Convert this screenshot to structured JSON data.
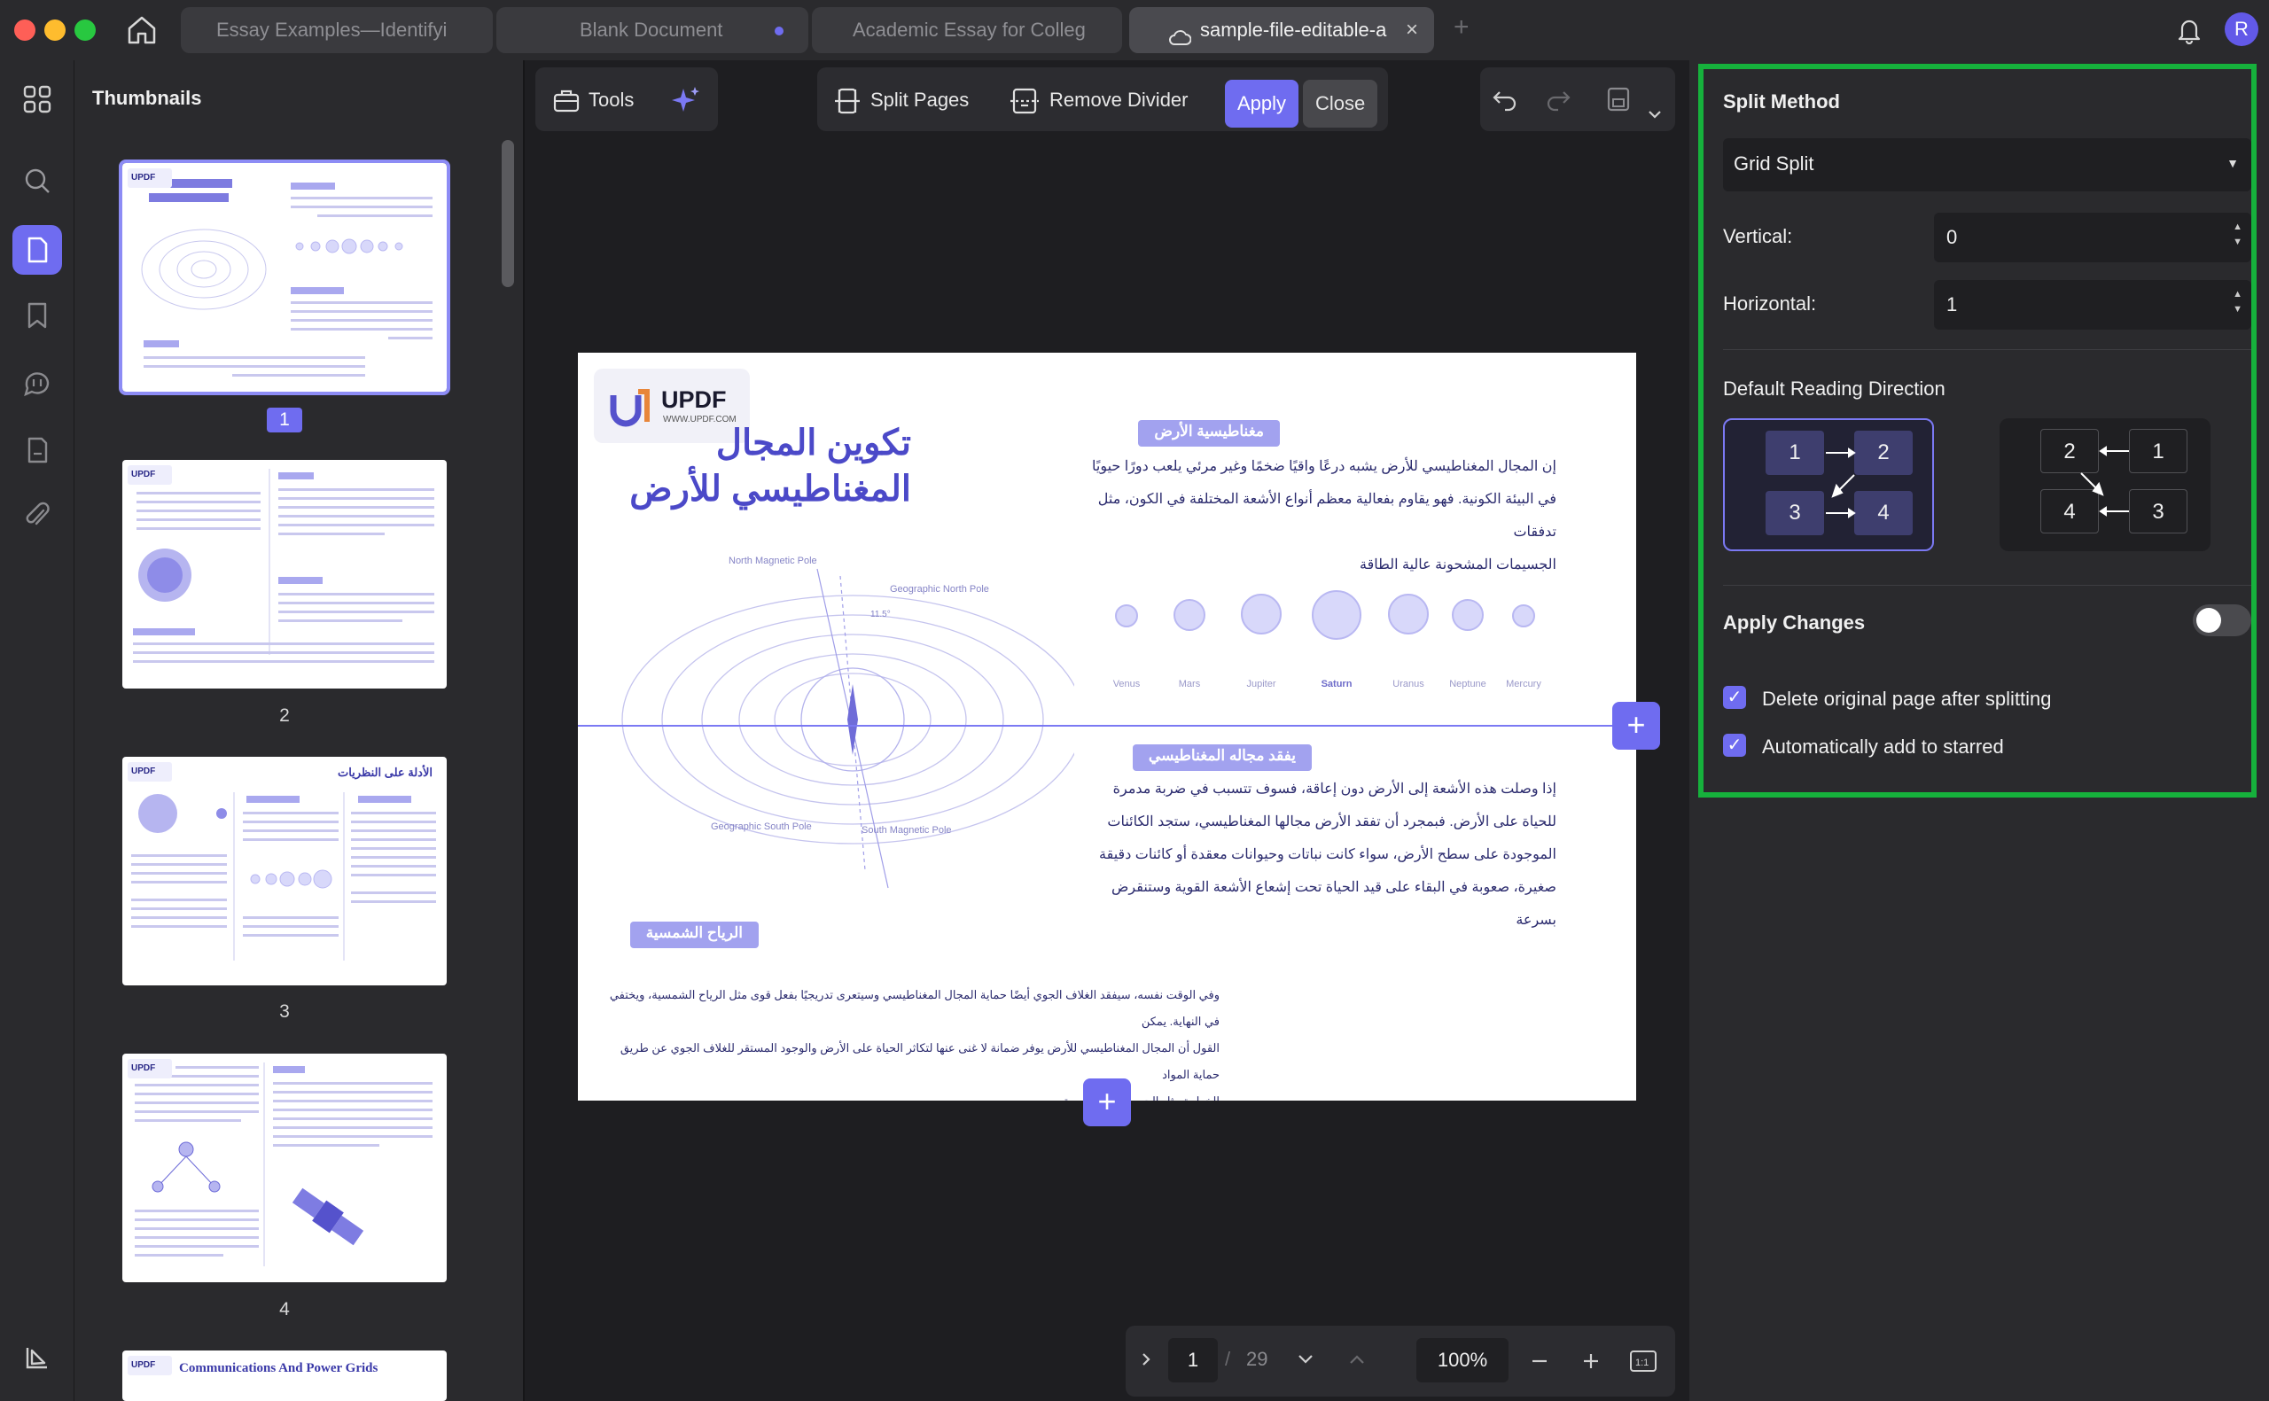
{
  "tabs": [
    {
      "label": "Essay Examples—Identifyi"
    },
    {
      "label": "Blank Document"
    },
    {
      "label": "Academic Essay for Colleg"
    },
    {
      "label": "sample-file-editable-a"
    }
  ],
  "user": {
    "avatar_initial": "R"
  },
  "thumbnails": {
    "title": "Thumbnails",
    "pages": [
      "1",
      "2",
      "3",
      "4"
    ],
    "page3_heading": "الأدلة على النظريات",
    "page5_heading": "Communications And Power Grids"
  },
  "toolbar": {
    "tools_label": "Tools",
    "split_pages_label": "Split Pages",
    "remove_divider_label": "Remove Divider",
    "apply_label": "Apply",
    "close_label": "Close"
  },
  "document": {
    "logo_brand": "UPDF",
    "logo_url": "WWW.UPDF.COM",
    "title_line1": "تكوين المجال",
    "title_line2": "المغناطيسي للأرض",
    "tag1": "مغناطيسية الأرض",
    "para1": [
      "إن المجال المغناطيسي للأرض يشبه درعًا واقيًا ضخمًا وغير مرئي يلعب دورًا حيويًا",
      "في البيئة الكونية. فهو يقاوم بفعالية معظم أنواع الأشعة المختلفة في الكون، مثل تدفقات",
      "الجسيمات المشحونة عالية الطاقة"
    ],
    "planets": [
      "Venus",
      "Mars",
      "Jupiter",
      "Saturn",
      "Uranus",
      "Neptune",
      "Mercury"
    ],
    "tag2": "يفقد مجاله المغناطيسي",
    "para2": [
      "إذا وصلت هذه الأشعة إلى الأرض دون إعاقة، فسوف تتسبب في ضربة مدمرة",
      "للحياة على الأرض. فبمجرد أن تفقد الأرض مجالها المغناطيسي، ستجد الكائنات",
      "الموجودة على سطح الأرض، سواء كانت نباتات وحيوانات معقدة أو كائنات دقيقة",
      "صغيرة، صعوبة في البقاء على قيد الحياة تحت إشعاع الأشعة القوية وستنقرض",
      "بسرعة"
    ],
    "tag3": "الرياح الشمسية",
    "para3": [
      "وفي الوقت نفسه، سيفقد الغلاف الجوي أيضًا حماية المجال المغناطيسي وسيتعرى تدريجيًا بفعل قوى مثل الرياح الشمسية، ويختفي في النهاية. يمكن",
      "القول أن المجال المغناطيسي للأرض يوفر ضمانة لا غنى عنها لتكاثر الحياة على الأرض والوجود المستقر للغلاف الجوي عن طريق حماية المواد",
      "الخطرة مثل الجسيمات الشمسية"
    ],
    "field_labels": {
      "north_magnetic": "North Magnetic Pole",
      "geographic_north": "Geographic North Pole",
      "geographic_south": "Geographic South Pole",
      "south_magnetic": "South Magnetic Pole",
      "angle": "11.5°"
    }
  },
  "pager": {
    "current_page": "1",
    "separator": "/",
    "total_pages": "29",
    "zoom": "100%"
  },
  "split_panel": {
    "method_title": "Split Method",
    "method_value": "Grid Split",
    "vertical_label": "Vertical:",
    "vertical_value": "0",
    "horizontal_label": "Horizontal:",
    "horizontal_value": "1",
    "reading_direction_title": "Default Reading Direction",
    "ltr_cells": [
      "1",
      "2",
      "3",
      "4"
    ],
    "rtl_cells": [
      "2",
      "1",
      "4",
      "3"
    ],
    "apply_changes_label": "Apply Changes",
    "apply_changes_on": false,
    "delete_original_label": "Delete original page after splitting",
    "delete_original_checked": true,
    "auto_star_label": "Automatically add to starred",
    "auto_star_checked": true
  },
  "colors": {
    "accent": "#6f6cf0",
    "highlight_border": "#16b13c"
  }
}
